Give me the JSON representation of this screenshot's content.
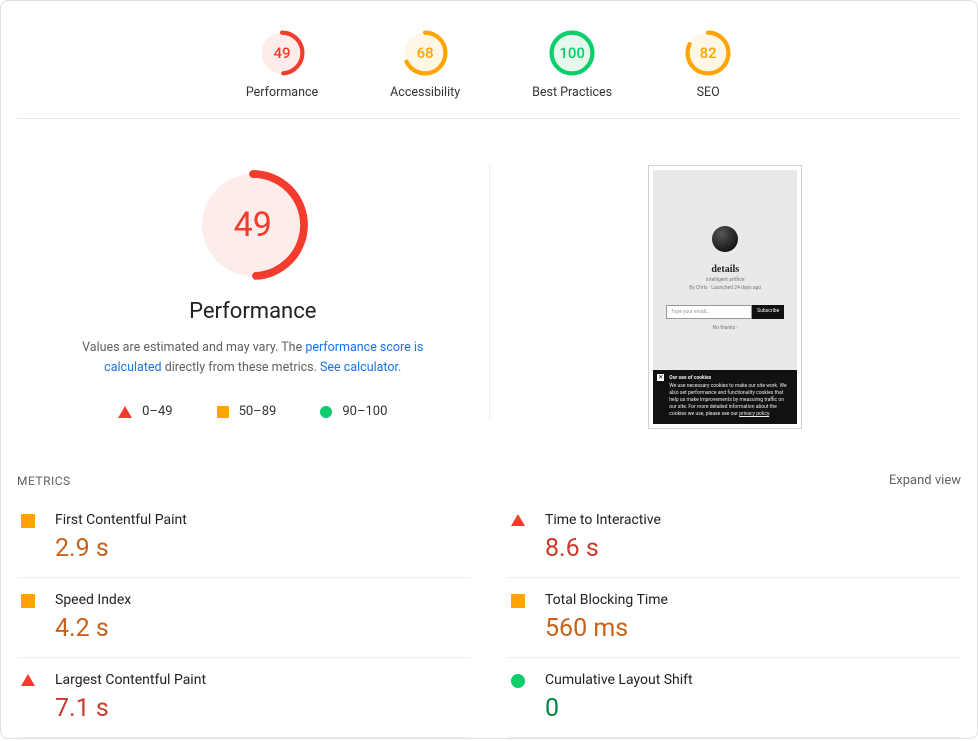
{
  "scores": [
    {
      "value": 49,
      "label": "Performance",
      "bucket": "red"
    },
    {
      "value": 68,
      "label": "Accessibility",
      "bucket": "orange"
    },
    {
      "value": 100,
      "label": "Best Practices",
      "bucket": "green"
    },
    {
      "value": 82,
      "label": "SEO",
      "bucket": "orange"
    }
  ],
  "detail": {
    "score": 49,
    "bucket": "red",
    "title": "Performance",
    "desc_prefix": "Values are estimated and may vary. The ",
    "link1": "performance score is calculated",
    "desc_middle": " directly from these metrics. ",
    "link2": "See calculator.",
    "legend": {
      "r": "0–49",
      "o": "50–89",
      "g": "90–100"
    }
  },
  "preview": {
    "title": "details",
    "subtitle": "intelligent artifice",
    "byline": "By Chris · Launched 24 days ago",
    "email_placeholder": "Type your email…",
    "subscribe": "Subscribe",
    "nothanks": "No thanks  ›",
    "cookie_title": "Our use of cookies",
    "cookie_body": "We use necessary cookies to make our site work. We also set performance and functionality cookies that help us make improvements by measuring traffic on our site. For more detailed information about the cookies we use, please see our ",
    "cookie_link": "privacy policy"
  },
  "metrics_header": {
    "title": "METRICS",
    "expand": "Expand view"
  },
  "metrics": [
    {
      "name": "First Contentful Paint",
      "value": "2.9 s",
      "bucket": "orange"
    },
    {
      "name": "Time to Interactive",
      "value": "8.6 s",
      "bucket": "red"
    },
    {
      "name": "Speed Index",
      "value": "4.2 s",
      "bucket": "orange"
    },
    {
      "name": "Total Blocking Time",
      "value": "560 ms",
      "bucket": "orange"
    },
    {
      "name": "Largest Contentful Paint",
      "value": "7.1 s",
      "bucket": "red"
    },
    {
      "name": "Cumulative Layout Shift",
      "value": "0",
      "bucket": "green"
    }
  ],
  "chart_data": {
    "type": "gauge",
    "title": "Lighthouse category scores",
    "ylim": [
      0,
      100
    ],
    "categories": [
      "Performance",
      "Accessibility",
      "Best Practices",
      "SEO"
    ],
    "values": [
      49,
      68,
      100,
      82
    ],
    "color_thresholds": {
      "red": "0–49",
      "orange": "50–89",
      "green": "90–100"
    }
  }
}
